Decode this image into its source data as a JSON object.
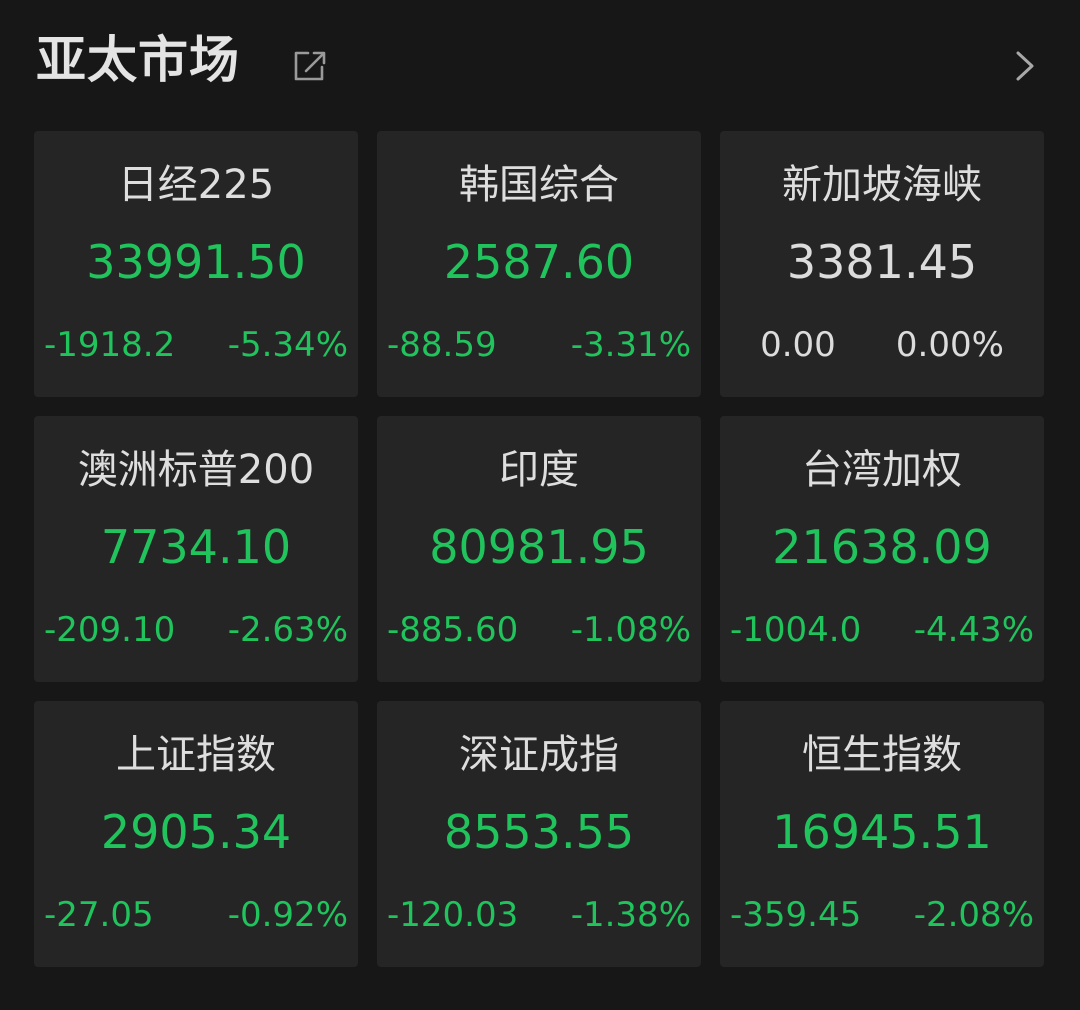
{
  "header": {
    "title": "亚太市场",
    "share_icon": "share-export-icon",
    "more_icon": "chevron-right-icon"
  },
  "colors": {
    "background": "#171717",
    "card": "#252525",
    "down": "#21c35d",
    "flat": "#dcdcdc"
  },
  "indices": [
    {
      "name": "日经225",
      "price": "33991.50",
      "change": "-1918.2",
      "pct": "-5.34%",
      "trend": "down"
    },
    {
      "name": "韩国综合",
      "price": "2587.60",
      "change": "-88.59",
      "pct": "-3.31%",
      "trend": "down"
    },
    {
      "name": "新加坡海峡",
      "price": "3381.45",
      "change": "0.00",
      "pct": "0.00%",
      "trend": "flat"
    },
    {
      "name": "澳洲标普200",
      "price": "7734.10",
      "change": "-209.10",
      "pct": "-2.63%",
      "trend": "down"
    },
    {
      "name": "印度",
      "price": "80981.95",
      "change": "-885.60",
      "pct": "-1.08%",
      "trend": "down"
    },
    {
      "name": "台湾加权",
      "price": "21638.09",
      "change": "-1004.0",
      "pct": "-4.43%",
      "trend": "down"
    },
    {
      "name": "上证指数",
      "price": "2905.34",
      "change": "-27.05",
      "pct": "-0.92%",
      "trend": "down"
    },
    {
      "name": "深证成指",
      "price": "8553.55",
      "change": "-120.03",
      "pct": "-1.38%",
      "trend": "down"
    },
    {
      "name": "恒生指数",
      "price": "16945.51",
      "change": "-359.45",
      "pct": "-2.08%",
      "trend": "down"
    }
  ]
}
